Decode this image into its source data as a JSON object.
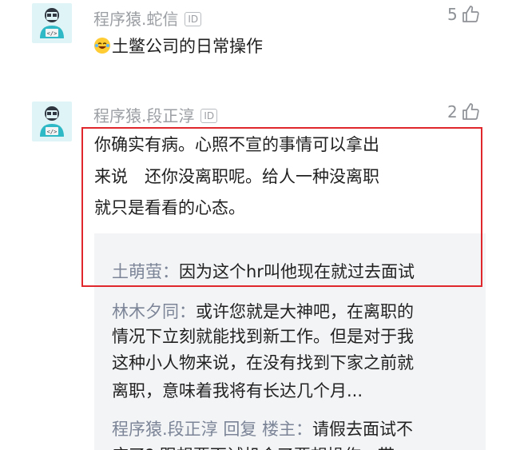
{
  "comments": [
    {
      "username": "程序猿.蛇信",
      "id_badge": "ID",
      "likes": "5",
      "text": "土鳖公司的日常操作",
      "emoji": "laughing-emoji"
    },
    {
      "username": "程序猿.段正淳",
      "id_badge": "ID",
      "likes": "2",
      "lines": [
        "你确实有病。心照不宣的事情可以拿出",
        "来说　还你没离职呢。给人一种没离职",
        "就只是看看的心态。"
      ]
    }
  ],
  "replies": [
    {
      "name": "土萌萤：",
      "lines": [
        "因为这个hr叫他现在就过去面试"
      ]
    },
    {
      "name": "林木夕同：",
      "lines": [
        "或许您就是大神吧，在离职的",
        "情况下立刻就能找到新工作。但是对于我",
        "这种小人物来说，在没有找到下家之前就",
        "离职，意味着我将有长达几个月..."
      ]
    },
    {
      "name": "程序猿.段正淳 回复 楼主：",
      "lines": [
        "请假去面试不",
        "应了? 跟想要面试机会了要想操作，带"
      ]
    }
  ],
  "icons": {
    "avatar": "robot-coder-avatar-icon",
    "like": "thumbs-up-icon"
  },
  "colors": {
    "highlight": "#e0282c",
    "avatar_bg": "#dff4f6",
    "username": "#9b9ea3"
  }
}
